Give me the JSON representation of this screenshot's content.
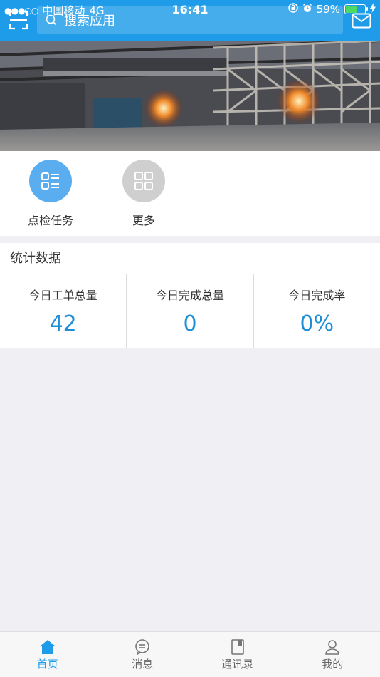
{
  "status_bar": {
    "signal": "●●●○○",
    "carrier": "中国移动",
    "network": "4G",
    "time": "16:41",
    "battery_percent": "59%",
    "battery_level": 0.59
  },
  "header": {
    "search_placeholder": "搜索应用"
  },
  "apps": [
    {
      "label": "点检任务",
      "icon": "list-icon",
      "color": "#5aaef0"
    },
    {
      "label": "更多",
      "icon": "grid-icon",
      "color": "#cfcfcf"
    }
  ],
  "stats": {
    "title": "统计数据",
    "items": [
      {
        "name": "今日工单总量",
        "value": "42"
      },
      {
        "name": "今日完成总量",
        "value": "0"
      },
      {
        "name": "今日完成率",
        "value": "0%"
      }
    ]
  },
  "tabbar": {
    "items": [
      {
        "label": "首页",
        "icon": "home-icon",
        "active": true
      },
      {
        "label": "消息",
        "icon": "message-icon",
        "active": false
      },
      {
        "label": "通讯录",
        "icon": "contacts-icon",
        "active": false
      },
      {
        "label": "我的",
        "icon": "user-icon",
        "active": false
      }
    ]
  },
  "colors": {
    "brand": "#1e9be9",
    "stat_value": "#1e8ed6"
  }
}
